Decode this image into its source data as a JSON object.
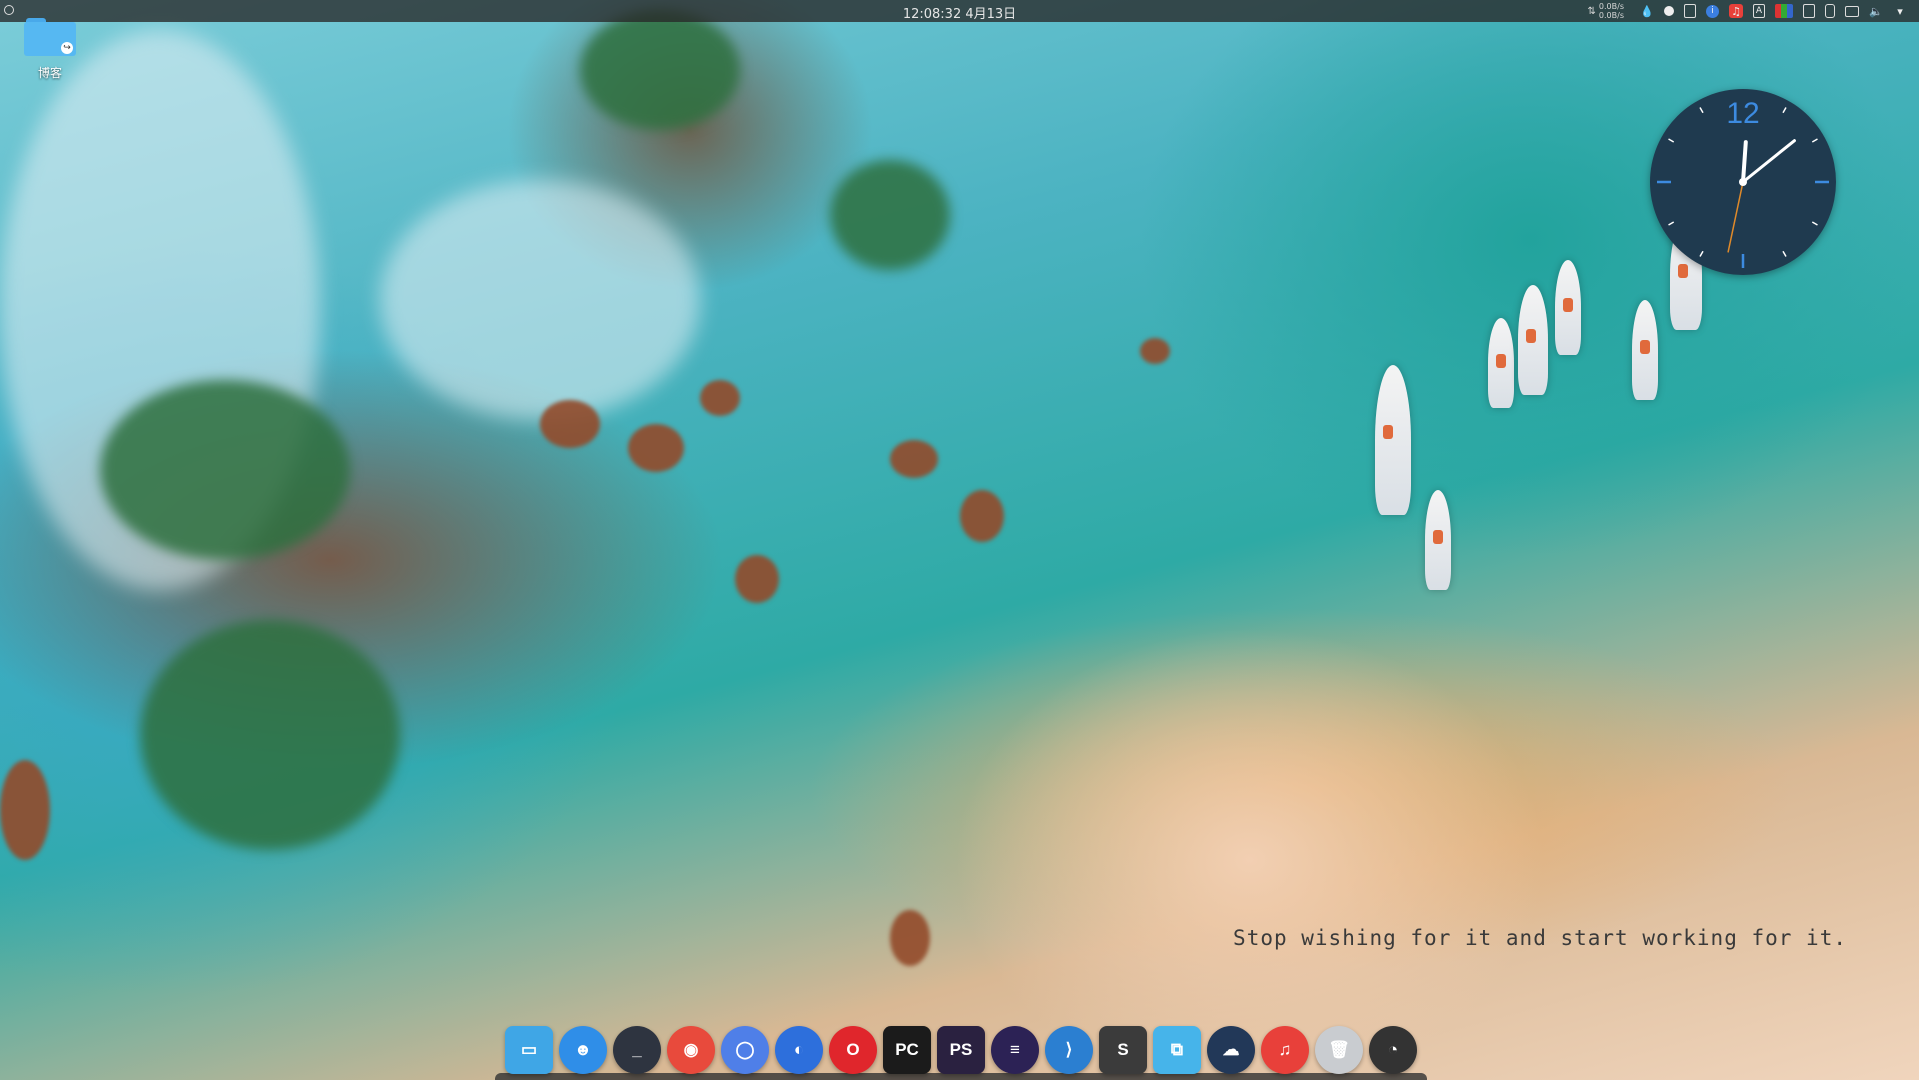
{
  "top_panel": {
    "datetime": "12:08:32 4月13日",
    "net_up": "0.0B/s",
    "net_down": "0.0B/s",
    "tray_icons": [
      "drop-icon",
      "record-dot-icon",
      "phone-icon",
      "info-icon",
      "netease-music-icon",
      "input-method-icon",
      "app-grid-icon",
      "clipboard-icon",
      "battery-icon",
      "display-icon",
      "volume-icon",
      "expand-icon"
    ]
  },
  "desktop": {
    "icons": [
      {
        "label": "博客",
        "icon": "folder-link-icon"
      }
    ],
    "quote": "Stop wishing for it and start working for it."
  },
  "clock_widget": {
    "numeral": "12",
    "hour": 12,
    "minute": 8,
    "second": 32,
    "face_color": "#1f3a4f",
    "numeral_color": "#3d8be0",
    "second_hand_color": "#e08a2a"
  },
  "dock": {
    "items": [
      {
        "name": "file-manager",
        "glyph": "▭",
        "bg": "#3fa6e6"
      },
      {
        "name": "finder",
        "glyph": "☻",
        "bg": "#2f8ee8"
      },
      {
        "name": "terminal",
        "glyph": "_",
        "bg": "#2e3440"
      },
      {
        "name": "chrome",
        "glyph": "◉",
        "bg": "#e84a3c"
      },
      {
        "name": "chromium",
        "glyph": "◯",
        "bg": "#4f7fe8"
      },
      {
        "name": "firefox",
        "glyph": "◐",
        "bg": "#2d6fdc"
      },
      {
        "name": "opera",
        "glyph": "O",
        "bg": "#e0262c"
      },
      {
        "name": "pycharm",
        "glyph": "PC",
        "bg": "#1b1b1b"
      },
      {
        "name": "phpstorm",
        "glyph": "PS",
        "bg": "#2a2140"
      },
      {
        "name": "eclipse",
        "glyph": "≡",
        "bg": "#2c2255"
      },
      {
        "name": "vscode",
        "glyph": "⟩",
        "bg": "#2b7fd1"
      },
      {
        "name": "sublime-text",
        "glyph": "S",
        "bg": "#3b3b3b"
      },
      {
        "name": "workspaces",
        "glyph": "⧉",
        "bg": "#46b4ea"
      },
      {
        "name": "cloud-app",
        "glyph": "☁",
        "bg": "#223858"
      },
      {
        "name": "netease-music",
        "glyph": "♫",
        "bg": "#e8403a"
      },
      {
        "name": "trash",
        "glyph": "🗑",
        "bg": "#c9ccd0"
      },
      {
        "name": "clock",
        "glyph": "◔",
        "bg": "#333333"
      }
    ]
  }
}
